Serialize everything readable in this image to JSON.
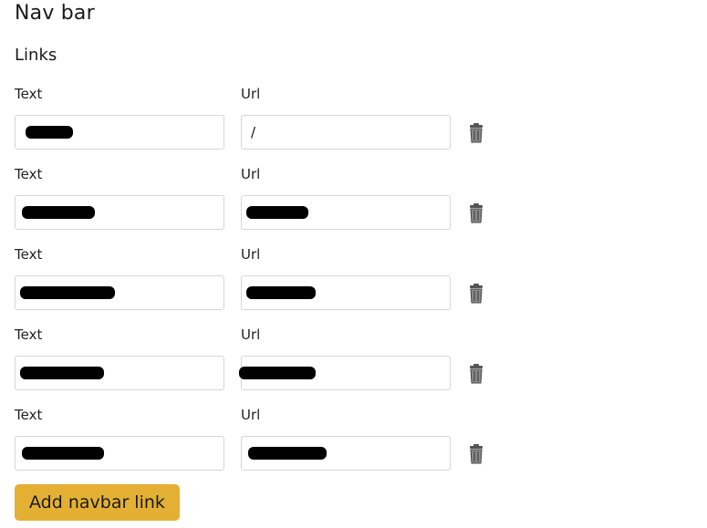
{
  "header": {
    "title": "Nav bar"
  },
  "section": {
    "title": "Links"
  },
  "links": [
    {
      "text_label": "Text",
      "url_label": "Url",
      "text_value": "",
      "url_value": "/"
    },
    {
      "text_label": "Text",
      "url_label": "Url",
      "text_value": "",
      "url_value": ""
    },
    {
      "text_label": "Text",
      "url_label": "Url",
      "text_value": "",
      "url_value": ""
    },
    {
      "text_label": "Text",
      "url_label": "Url",
      "text_value": "",
      "url_value": ""
    },
    {
      "text_label": "Text",
      "url_label": "Url",
      "text_value": "",
      "url_value": ""
    }
  ],
  "icons": {
    "delete": "trash-icon"
  },
  "actions": {
    "add_label": "Add navbar link"
  },
  "colors": {
    "accent": "#e4b034",
    "border": "#d6d6d6"
  }
}
